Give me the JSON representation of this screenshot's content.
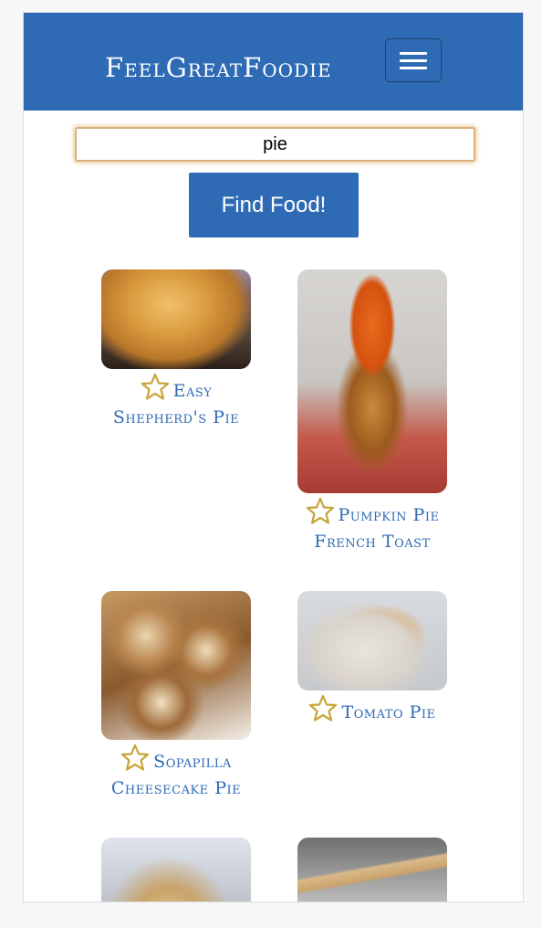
{
  "navbar": {
    "brand": "FeelGreatFoodie",
    "menu_icon": "hamburger-menu-icon",
    "color": "#2f6bb5"
  },
  "search": {
    "value": "pie",
    "button_label": "Find Food!"
  },
  "results": [
    {
      "title": "Easy Shepherd's Pie",
      "icon": "star-outline-icon"
    },
    {
      "title": "Pumpkin Pie French Toast",
      "icon": "star-outline-icon"
    },
    {
      "title": "Sopapilla Cheesecake Pie",
      "icon": "star-outline-icon"
    },
    {
      "title": "Tomato Pie",
      "icon": "star-outline-icon"
    },
    {
      "title": "",
      "icon": ""
    },
    {
      "title": "",
      "icon": ""
    }
  ],
  "colors": {
    "accent": "#2f6bb5",
    "star": "#c9a43a"
  }
}
